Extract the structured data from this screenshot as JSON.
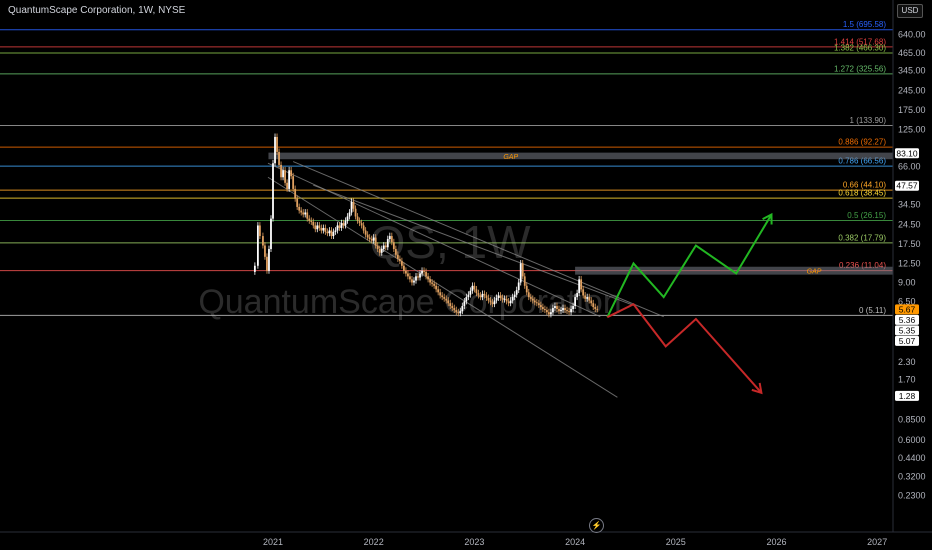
{
  "symbol": {
    "title": "QuantumScape Corporation, 1W, NYSE"
  },
  "currency": {
    "label": "USD"
  },
  "watermark": {
    "ticker": "QS, 1W",
    "name": "QuantumScape Corporation"
  },
  "colors": {
    "background": "#000000",
    "candle_up": "#ffffff",
    "candle_down": "#e0a060",
    "green_path": "#22b722",
    "red_path": "#c62828",
    "gap": "#787b86",
    "channel": "#8a8a8a"
  },
  "chart_data": {
    "type": "candlestick",
    "title": "",
    "y_scale": "log",
    "ylim": [
      0.2,
      760
    ],
    "x_years": [
      "2021",
      "2022",
      "2023",
      "2024",
      "2025",
      "2026",
      "2027"
    ],
    "y_ticks": [
      "640.00",
      "465.00",
      "345.00",
      "245.00",
      "175.00",
      "125.00",
      "66.00",
      "34.50",
      "24.50",
      "17.50",
      "12.50",
      "9.00",
      "6.50",
      "2.30",
      "1.70",
      "0.8500",
      "0.6000",
      "0.4400",
      "0.3200",
      "0.2300"
    ],
    "fib_levels": [
      {
        "label": "1.5 (695.58)",
        "value": 695.58,
        "color": "#2962ff"
      },
      {
        "label": "1.414 (517.68)",
        "value": 517.68,
        "color": "#e04040"
      },
      {
        "label": "1.382 (466.30)",
        "value": 466.3,
        "color": "#8bc34a"
      },
      {
        "label": "1.272 (325.56)",
        "value": 325.56,
        "color": "#66bb6a"
      },
      {
        "label": "1 (133.90)",
        "value": 133.9,
        "color": "#9e9e9e"
      },
      {
        "label": "0.886 (92.27)",
        "value": 92.27,
        "color": "#ef6c00"
      },
      {
        "label": "0.786 (66.56)",
        "value": 66.56,
        "color": "#42a5f5"
      },
      {
        "label": "0.66 (44.10)",
        "value": 44.1,
        "color": "#ffa726"
      },
      {
        "label": "0.618 (38.45)",
        "value": 38.45,
        "color": "#fdd835"
      },
      {
        "label": "0.5 (26.15)",
        "value": 26.15,
        "color": "#43a047"
      },
      {
        "label": "0.382 (17.79)",
        "value": 17.79,
        "color": "#9ccc65"
      },
      {
        "label": "0.236 (11.04)",
        "value": 11.04,
        "color": "#ef5350"
      },
      {
        "label": "0 (5.11)",
        "value": 5.11,
        "color": "#bdbdbd"
      }
    ],
    "gaps": [
      {
        "label": "GAP",
        "low": 75.0,
        "high": 84.0,
        "from": "2020-12-15"
      },
      {
        "label": "GAP",
        "low": 10.3,
        "high": 11.8,
        "from": "2024-01-01"
      }
    ],
    "price_tags": [
      {
        "label": "83.10",
        "value": 83.1,
        "bg": "#ffffff",
        "fg": "#000000"
      },
      {
        "label": "47.57",
        "value": 47.57,
        "bg": "#ffffff",
        "fg": "#000000"
      },
      {
        "label": "5.67",
        "value": 5.67,
        "bg": "#ff9800",
        "fg": "#000000"
      },
      {
        "label": "5.36",
        "value": 5.36,
        "bg": "#ffffff",
        "fg": "#000000"
      },
      {
        "label": "5.35",
        "value": 5.35,
        "bg": "#ffffff",
        "fg": "#000000"
      },
      {
        "label": "5.07",
        "value": 5.07,
        "bg": "#ffffff",
        "fg": "#000000"
      },
      {
        "label": "1.28",
        "value": 1.28,
        "bg": "#ffffff",
        "fg": "#000000"
      }
    ],
    "weekly_close": [
      [
        2020.82,
        12.0
      ],
      [
        2020.85,
        24.0
      ],
      [
        2020.87,
        20.0
      ],
      [
        2020.9,
        17.0
      ],
      [
        2020.92,
        14.0
      ],
      [
        2020.94,
        11.0
      ],
      [
        2020.96,
        16.0
      ],
      [
        2020.98,
        27.0
      ],
      [
        2021.0,
        70.0
      ],
      [
        2021.02,
        110.0
      ],
      [
        2021.04,
        85.0
      ],
      [
        2021.06,
        68.0
      ],
      [
        2021.08,
        55.0
      ],
      [
        2021.1,
        62.0
      ],
      [
        2021.12,
        50.0
      ],
      [
        2021.14,
        45.0
      ],
      [
        2021.16,
        62.0
      ],
      [
        2021.18,
        56.0
      ],
      [
        2021.2,
        45.0
      ],
      [
        2021.22,
        38.0
      ],
      [
        2021.24,
        33.0
      ],
      [
        2021.26,
        31.0
      ],
      [
        2021.28,
        30.0
      ],
      [
        2021.3,
        29.0
      ],
      [
        2021.32,
        30.0
      ],
      [
        2021.34,
        27.0
      ],
      [
        2021.36,
        26.0
      ],
      [
        2021.38,
        25.5
      ],
      [
        2021.4,
        24.0
      ],
      [
        2021.42,
        22.5
      ],
      [
        2021.44,
        24.0
      ],
      [
        2021.46,
        23.0
      ],
      [
        2021.48,
        22.0
      ],
      [
        2021.5,
        23.0
      ],
      [
        2021.52,
        21.5
      ],
      [
        2021.54,
        21.0
      ],
      [
        2021.56,
        22.0
      ],
      [
        2021.58,
        20.0
      ],
      [
        2021.6,
        21.5
      ],
      [
        2021.62,
        22.0
      ],
      [
        2021.64,
        24.0
      ],
      [
        2021.66,
        23.0
      ],
      [
        2021.68,
        25.0
      ],
      [
        2021.7,
        24.0
      ],
      [
        2021.72,
        26.0
      ],
      [
        2021.74,
        28.0
      ],
      [
        2021.76,
        30.0
      ],
      [
        2021.78,
        36.0
      ],
      [
        2021.8,
        32.0
      ],
      [
        2021.82,
        28.0
      ],
      [
        2021.84,
        26.0
      ],
      [
        2021.86,
        25.0
      ],
      [
        2021.88,
        24.0
      ],
      [
        2021.9,
        22.0
      ],
      [
        2021.92,
        20.5
      ],
      [
        2021.94,
        19.5
      ],
      [
        2021.96,
        19.0
      ],
      [
        2021.98,
        18.5
      ],
      [
        2022.0,
        19.5
      ],
      [
        2022.02,
        17.0
      ],
      [
        2022.04,
        16.0
      ],
      [
        2022.06,
        15.0
      ],
      [
        2022.08,
        16.0
      ],
      [
        2022.1,
        17.0
      ],
      [
        2022.12,
        16.5
      ],
      [
        2022.14,
        19.0
      ],
      [
        2022.16,
        20.0
      ],
      [
        2022.18,
        18.0
      ],
      [
        2022.2,
        16.0
      ],
      [
        2022.22,
        14.5
      ],
      [
        2022.24,
        13.5
      ],
      [
        2022.26,
        13.0
      ],
      [
        2022.28,
        12.0
      ],
      [
        2022.3,
        11.0
      ],
      [
        2022.32,
        10.5
      ],
      [
        2022.34,
        10.0
      ],
      [
        2022.36,
        9.5
      ],
      [
        2022.38,
        9.0
      ],
      [
        2022.4,
        9.3
      ],
      [
        2022.42,
        10.0
      ],
      [
        2022.44,
        9.8
      ],
      [
        2022.46,
        10.5
      ],
      [
        2022.48,
        11.0
      ],
      [
        2022.5,
        10.8
      ],
      [
        2022.52,
        10.0
      ],
      [
        2022.54,
        9.5
      ],
      [
        2022.56,
        9.0
      ],
      [
        2022.58,
        8.8
      ],
      [
        2022.6,
        8.5
      ],
      [
        2022.62,
        8.0
      ],
      [
        2022.64,
        7.6
      ],
      [
        2022.66,
        7.2
      ],
      [
        2022.68,
        7.0
      ],
      [
        2022.7,
        6.8
      ],
      [
        2022.72,
        6.6
      ],
      [
        2022.74,
        6.3
      ],
      [
        2022.76,
        6.0
      ],
      [
        2022.78,
        5.8
      ],
      [
        2022.8,
        5.6
      ],
      [
        2022.82,
        5.4
      ],
      [
        2022.84,
        5.3
      ],
      [
        2022.86,
        5.5
      ],
      [
        2022.88,
        6.0
      ],
      [
        2022.9,
        6.5
      ],
      [
        2022.92,
        7.0
      ],
      [
        2022.94,
        7.3
      ],
      [
        2022.96,
        7.8
      ],
      [
        2022.98,
        8.5
      ],
      [
        2023.0,
        8.0
      ],
      [
        2023.02,
        7.5
      ],
      [
        2023.04,
        7.2
      ],
      [
        2023.06,
        7.0
      ],
      [
        2023.08,
        7.4
      ],
      [
        2023.1,
        7.2
      ],
      [
        2023.12,
        6.9
      ],
      [
        2023.14,
        6.6
      ],
      [
        2023.16,
        6.4
      ],
      [
        2023.18,
        6.2
      ],
      [
        2023.2,
        6.6
      ],
      [
        2023.22,
        6.9
      ],
      [
        2023.24,
        7.2
      ],
      [
        2023.26,
        6.9
      ],
      [
        2023.28,
        6.7
      ],
      [
        2023.3,
        6.8
      ],
      [
        2023.32,
        6.5
      ],
      [
        2023.34,
        6.3
      ],
      [
        2023.36,
        6.6
      ],
      [
        2023.38,
        7.0
      ],
      [
        2023.4,
        7.3
      ],
      [
        2023.42,
        7.9
      ],
      [
        2023.44,
        9.0
      ],
      [
        2023.46,
        12.5
      ],
      [
        2023.48,
        10.0
      ],
      [
        2023.5,
        8.5
      ],
      [
        2023.52,
        7.6
      ],
      [
        2023.54,
        7.0
      ],
      [
        2023.56,
        6.8
      ],
      [
        2023.58,
        6.6
      ],
      [
        2023.6,
        6.4
      ],
      [
        2023.62,
        6.3
      ],
      [
        2023.64,
        6.1
      ],
      [
        2023.66,
        5.9
      ],
      [
        2023.68,
        5.7
      ],
      [
        2023.7,
        5.6
      ],
      [
        2023.72,
        5.4
      ],
      [
        2023.74,
        5.2
      ],
      [
        2023.76,
        5.4
      ],
      [
        2023.78,
        5.8
      ],
      [
        2023.8,
        6.0
      ],
      [
        2023.82,
        5.7
      ],
      [
        2023.84,
        5.5
      ],
      [
        2023.86,
        5.6
      ],
      [
        2023.88,
        5.8
      ],
      [
        2023.9,
        5.6
      ],
      [
        2023.92,
        5.5
      ],
      [
        2023.94,
        5.4
      ],
      [
        2023.96,
        5.7
      ],
      [
        2023.98,
        6.0
      ],
      [
        2024.0,
        7.0
      ],
      [
        2024.02,
        7.5
      ],
      [
        2024.04,
        9.5
      ],
      [
        2024.06,
        8.0
      ],
      [
        2024.08,
        7.2
      ],
      [
        2024.1,
        6.8
      ],
      [
        2024.12,
        7.0
      ],
      [
        2024.14,
        6.6
      ],
      [
        2024.16,
        6.3
      ],
      [
        2024.18,
        5.9
      ],
      [
        2024.2,
        5.7
      ],
      [
        2024.22,
        5.67
      ]
    ],
    "channel_lines": [
      {
        "from": [
          2020.95,
          70.0
        ],
        "to": [
          2024.25,
          5.0
        ]
      },
      {
        "from": [
          2021.2,
          72.0
        ],
        "to": [
          2024.88,
          5.0
        ]
      },
      {
        "from": [
          2021.4,
          48.0
        ],
        "to": [
          2024.6,
          6.0
        ]
      },
      {
        "from": [
          2020.95,
          55.0
        ],
        "to": [
          2024.42,
          1.25
        ]
      }
    ],
    "projections": [
      {
        "name": "bullish",
        "points": [
          [
            2024.32,
            4.95
          ],
          [
            2024.58,
            12.5
          ],
          [
            2024.88,
            7.0
          ],
          [
            2025.2,
            17.0
          ],
          [
            2025.6,
            10.5
          ],
          [
            2025.95,
            29.0
          ]
        ]
      },
      {
        "name": "bearish",
        "points": [
          [
            2024.32,
            4.95
          ],
          [
            2024.58,
            6.2
          ],
          [
            2024.9,
            3.0
          ],
          [
            2025.2,
            4.8
          ],
          [
            2025.85,
            1.35
          ]
        ]
      }
    ]
  }
}
